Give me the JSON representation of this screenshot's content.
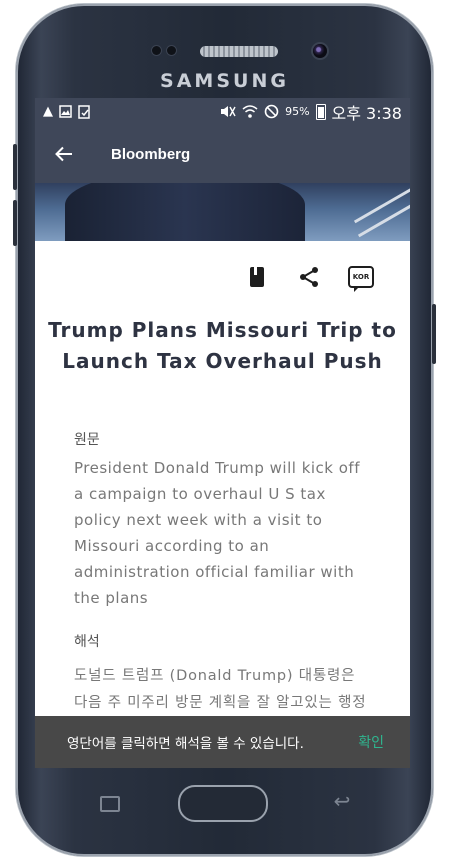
{
  "device": {
    "brand": "SAMSUNG"
  },
  "status_bar": {
    "left_icons": [
      "warning-icon",
      "image-icon",
      "clipboard-icon"
    ],
    "right_icons": [
      "mute-icon",
      "wifi-icon",
      "no-disturb-icon"
    ],
    "battery_percent": "95%",
    "time": "오후 3:38"
  },
  "app_bar": {
    "title": "Bloomberg",
    "back_icon": "←"
  },
  "article": {
    "title": "Trump Plans Missouri Trip to Launch Tax Overhaul Push",
    "original_label": "원문",
    "original_text": "President Donald Trump will kick off a campaign to overhaul U S  tax policy next week with a visit to Missouri according to an administration official familiar with the plans",
    "translation_label": "해석",
    "translation_text": "도널드 트럼프 (Donald Trump) 대통령은 다음 주 미주리 방문 계획을 잘 알고있는 행정부 관리에 따르면 미국 세금 정책을 정밀"
  },
  "actions": {
    "kor_label": "KOR"
  },
  "snackbar": {
    "message": "영단어를 클릭하면 해석을 볼 수 있습니다.",
    "action": "확인"
  },
  "colors": {
    "app_bar": "#3f4759",
    "accent": "#2fb58f",
    "snackbar": "#484848"
  }
}
